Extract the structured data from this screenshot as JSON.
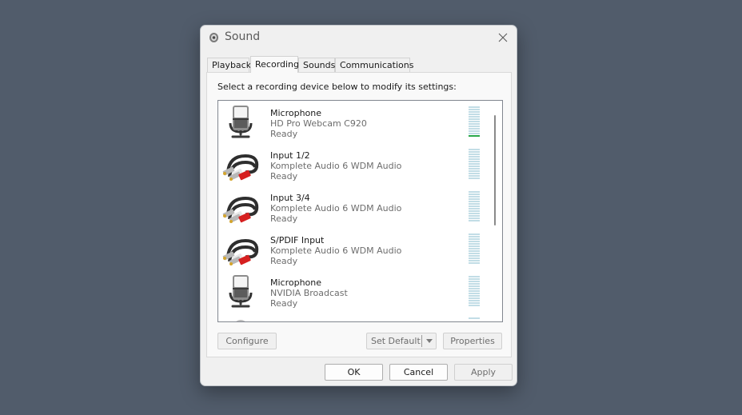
{
  "window": {
    "title": "Sound",
    "icon": "speaker-icon",
    "close_icon": "close-icon"
  },
  "tabs": [
    {
      "label": "Playback",
      "active": false
    },
    {
      "label": "Recording",
      "active": true
    },
    {
      "label": "Sounds",
      "active": false
    },
    {
      "label": "Communications",
      "active": false
    }
  ],
  "panel": {
    "instruction": "Select a recording device below to modify its settings:"
  },
  "devices": [
    {
      "name": "Microphone",
      "description": "HD Pro Webcam C920",
      "status": "Ready",
      "icon": "microphone-icon",
      "level": 0.1
    },
    {
      "name": "Input 1/2",
      "description": "Komplete Audio 6 WDM Audio",
      "status": "Ready",
      "icon": "rca-cable-icon",
      "level": 0
    },
    {
      "name": "Input 3/4",
      "description": "Komplete Audio 6 WDM Audio",
      "status": "Ready",
      "icon": "rca-cable-icon",
      "level": 0
    },
    {
      "name": "S/PDIF Input",
      "description": "Komplete Audio 6 WDM Audio",
      "status": "Ready",
      "icon": "rca-cable-icon",
      "level": 0
    },
    {
      "name": "Microphone",
      "description": "NVIDIA Broadcast",
      "status": "Ready",
      "icon": "microphone-icon",
      "level": 0
    }
  ],
  "buttons": {
    "configure": "Configure",
    "set_default": "Set Default",
    "properties": "Properties",
    "ok": "OK",
    "cancel": "Cancel",
    "apply": "Apply"
  },
  "colors": {
    "meter_idle": "#c2dde6",
    "meter_active": "#2aa84a"
  }
}
